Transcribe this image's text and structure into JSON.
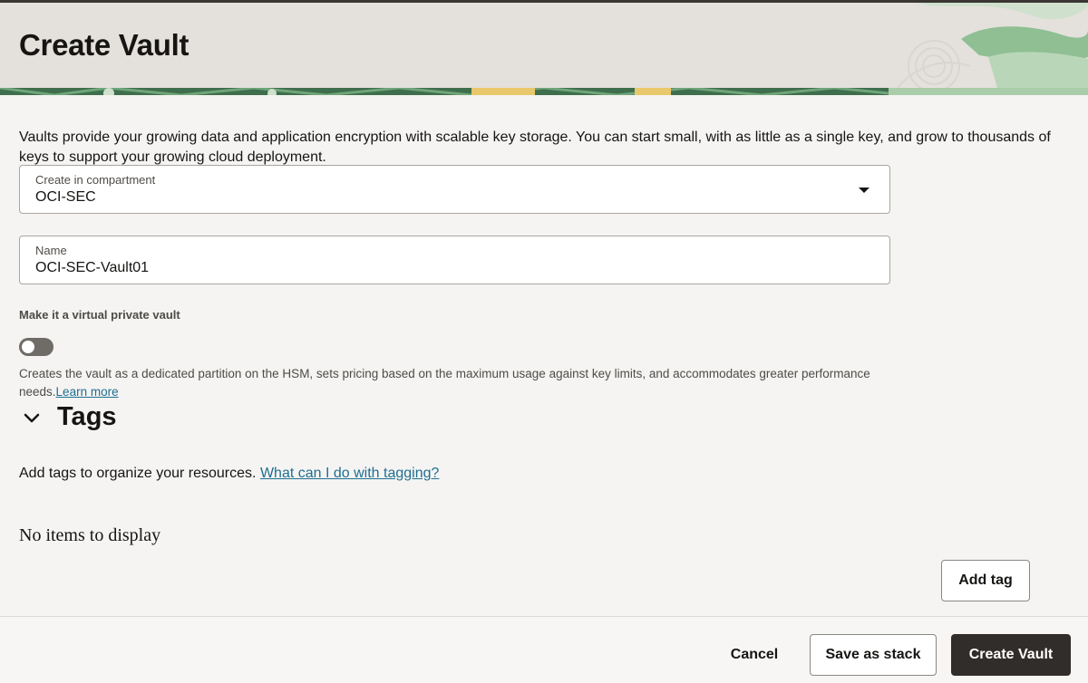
{
  "header": {
    "title": "Create Vault"
  },
  "intro": "Vaults provide your growing data and application encryption with scalable key storage. You can start small, with as little as a single key, and grow to thousands of keys to support your growing cloud deployment.",
  "compartment": {
    "label": "Create in compartment",
    "value": "OCI-SEC"
  },
  "name_field": {
    "label": "Name",
    "value": "OCI-SEC-Vault01"
  },
  "virtual_private": {
    "label": "Make it a virtual private vault",
    "enabled": false,
    "help": "Creates the vault as a dedicated partition on the HSM, sets pricing based on the maximum usage against key limits, and accommodates greater performance needs.",
    "link": "Learn more"
  },
  "tags": {
    "heading": "Tags",
    "description": "Add tags to organize your resources.",
    "link": "What can I do with tagging?",
    "empty": "No items to display",
    "add_label": "Add tag"
  },
  "footer": {
    "cancel_label": "Cancel",
    "stack_label": "Save as stack",
    "create_label": "Create Vault"
  },
  "colors": {
    "primary_button": "#312d2a",
    "link": "#1f6f92",
    "header_bg": "#e4e1dc",
    "accent_green": "#5f9e6e"
  }
}
